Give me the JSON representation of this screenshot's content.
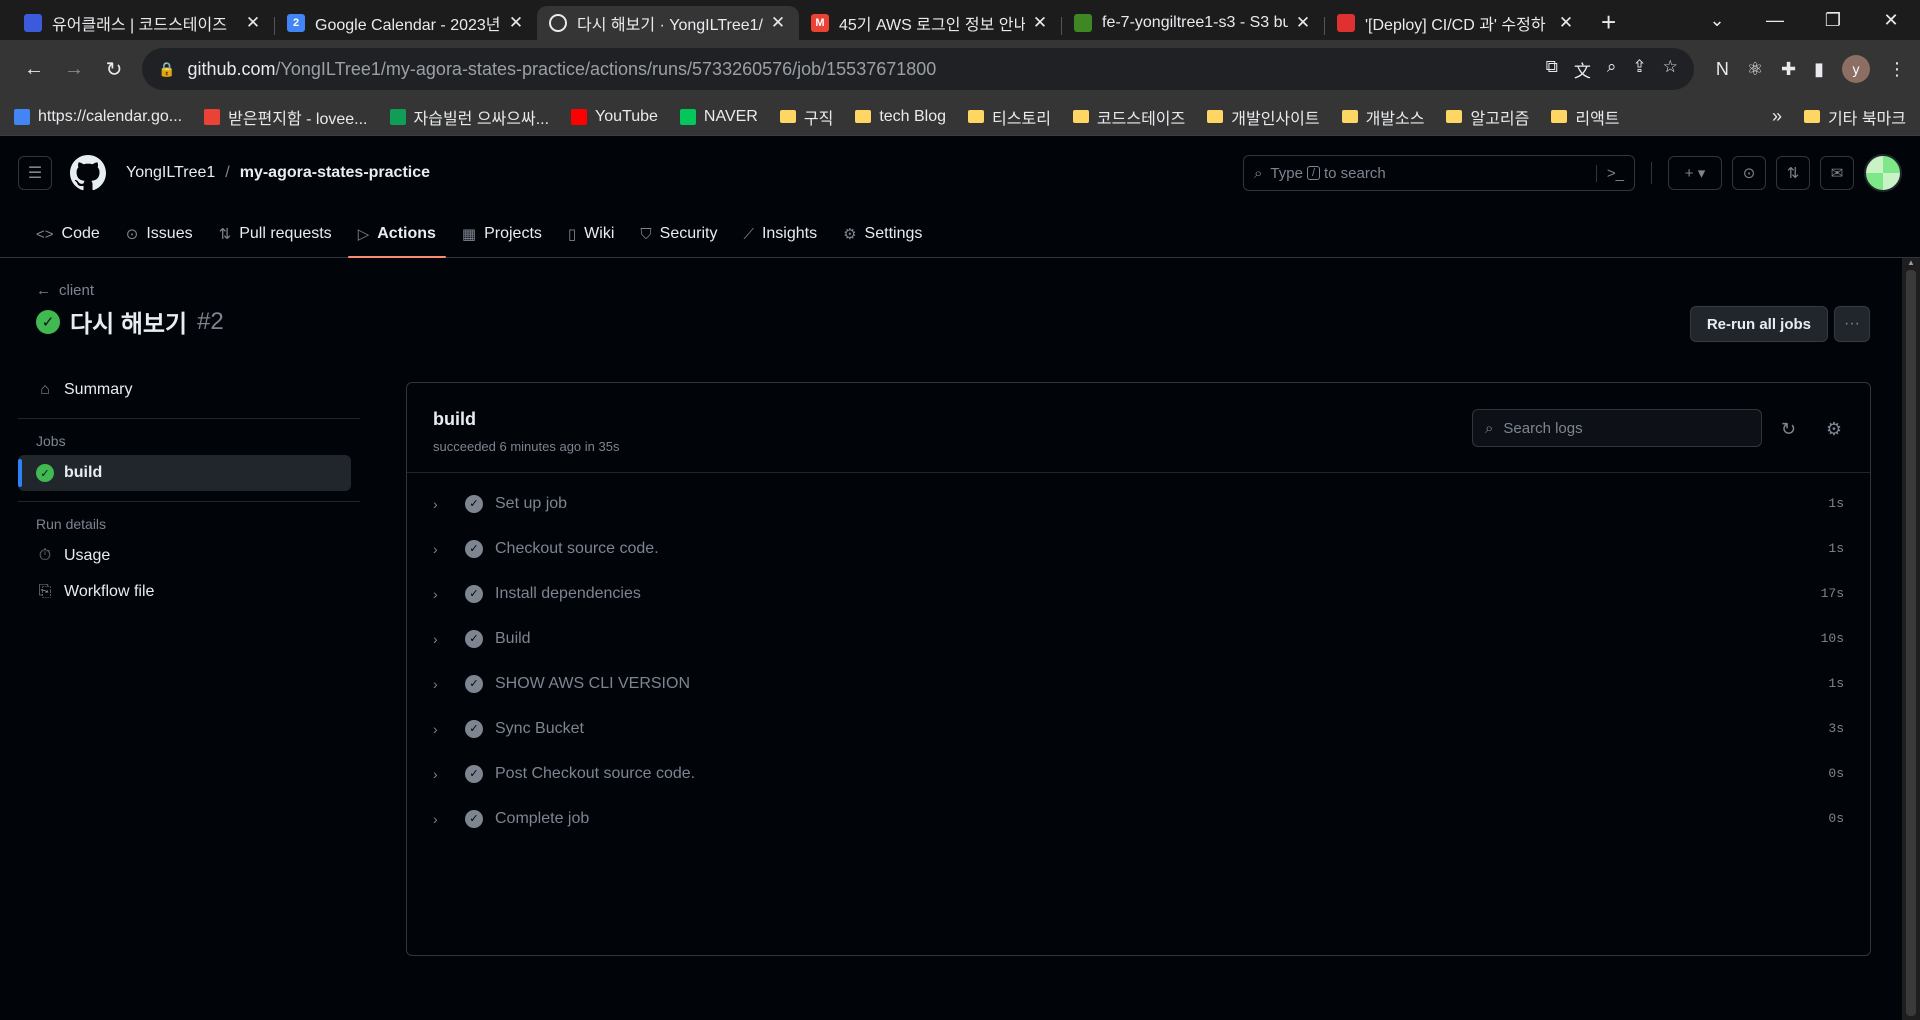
{
  "browser": {
    "tabs": [
      {
        "title": "유어클래스 | 코드스테이즈",
        "favicon_color": "#3b5bdb",
        "favicon_text": ""
      },
      {
        "title": "Google Calendar - 2023년",
        "favicon_color": "#4285f4",
        "favicon_text": "2"
      },
      {
        "title": "다시 해보기 · YongILTree1/",
        "favicon_color": "#e8eaed",
        "favicon_text": ""
      },
      {
        "title": "45기 AWS 로그인 정보 안내",
        "favicon_color": "#ea4335",
        "favicon_text": "M"
      },
      {
        "title": "fe-7-yongiltree1-s3 - S3 bu",
        "favicon_color": "#3f8624",
        "favicon_text": ""
      },
      {
        "title": "'[Deploy] CI/CD 과' 수정하",
        "favicon_color": "#e03131",
        "favicon_text": ""
      }
    ],
    "url_host": "github.com",
    "url_path": "/YongILTree1/my-agora-states-practice/actions/runs/5733260576/job/15537671800",
    "profile_initial": "y",
    "bookmarks": [
      {
        "label": "https://calendar.go...",
        "type": "calendar"
      },
      {
        "label": "받은편지함 - lovee...",
        "type": "gmail"
      },
      {
        "label": "자습빌런 으싸으싸...",
        "type": "plus"
      },
      {
        "label": "YouTube",
        "type": "youtube"
      },
      {
        "label": "NAVER",
        "type": "naver"
      },
      {
        "label": "구직",
        "type": "folder"
      },
      {
        "label": "tech Blog",
        "type": "folder"
      },
      {
        "label": "티스토리",
        "type": "folder"
      },
      {
        "label": "코드스테이즈",
        "type": "folder"
      },
      {
        "label": "개발인사이트",
        "type": "folder"
      },
      {
        "label": "개발소스",
        "type": "folder"
      },
      {
        "label": "알고리즘",
        "type": "folder"
      },
      {
        "label": "리액트",
        "type": "folder"
      }
    ],
    "other_bookmarks": "기타 북마크"
  },
  "header": {
    "owner": "YongILTree1",
    "separator": "/",
    "repo": "my-agora-states-practice",
    "search_prefix": "Type",
    "search_key": "/",
    "search_suffix": "to search"
  },
  "repo_nav": [
    {
      "label": "Code",
      "icon": "code-icon"
    },
    {
      "label": "Issues",
      "icon": "issue-icon"
    },
    {
      "label": "Pull requests",
      "icon": "pull-request-icon"
    },
    {
      "label": "Actions",
      "icon": "play-icon"
    },
    {
      "label": "Projects",
      "icon": "table-icon"
    },
    {
      "label": "Wiki",
      "icon": "book-icon"
    },
    {
      "label": "Security",
      "icon": "shield-icon"
    },
    {
      "label": "Insights",
      "icon": "graph-icon"
    },
    {
      "label": "Settings",
      "icon": "gear-icon"
    }
  ],
  "run": {
    "back_label": "client",
    "title": "다시 해보기",
    "number": "#2",
    "rerun_label": "Re-run all jobs"
  },
  "sidebar": {
    "summary_label": "Summary",
    "jobs_heading": "Jobs",
    "job_label": "build",
    "details_heading": "Run details",
    "usage_label": "Usage",
    "workflow_label": "Workflow file"
  },
  "job": {
    "name": "build",
    "status": "succeeded 6 minutes ago in 35s",
    "search_placeholder": "Search logs",
    "steps": [
      {
        "name": "Set up job",
        "duration": "1s"
      },
      {
        "name": "Checkout source code.",
        "duration": "1s"
      },
      {
        "name": "Install dependencies",
        "duration": "17s"
      },
      {
        "name": "Build",
        "duration": "10s"
      },
      {
        "name": "SHOW AWS CLI VERSION",
        "duration": "1s"
      },
      {
        "name": "Sync Bucket",
        "duration": "3s"
      },
      {
        "name": "Post Checkout source code.",
        "duration": "0s"
      },
      {
        "name": "Complete job",
        "duration": "0s"
      }
    ]
  },
  "colors": {
    "success": "#3fb950",
    "active_tab_underline": "#fd8c73",
    "sidebar_active_bar": "#2f81f7"
  }
}
